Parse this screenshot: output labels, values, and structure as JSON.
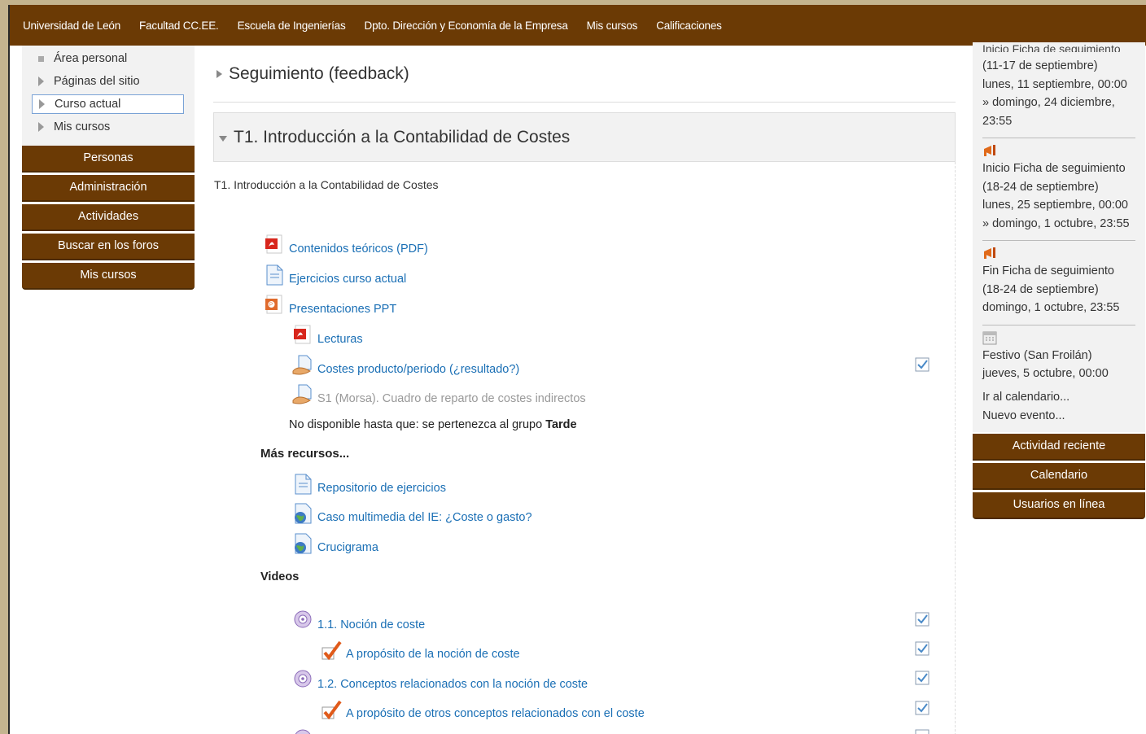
{
  "topnav": {
    "items": [
      "Universidad de León",
      "Facultad CC.EE.",
      "Escuela de Ingenierías",
      "Dpto. Dirección y Economía de la Empresa",
      "Mis cursos",
      "Calificaciones"
    ]
  },
  "navtree": {
    "items": [
      "Área personal",
      "Páginas del sitio",
      "Curso actual",
      "Mis cursos"
    ]
  },
  "left_blocks": [
    "Personas",
    "Administración",
    "Actividades",
    "Buscar en los foros",
    "Mis cursos"
  ],
  "events": {
    "clipped_text": "Inicio Ficha de seguimiento",
    "e1": {
      "l1": "(11-17 de septiembre)",
      "l2": "lunes, 11 septiembre, 00:00",
      "l3": "» domingo, 24 diciembre,",
      "l4": "23:55"
    },
    "e2": {
      "l1": "Inicio Ficha de seguimiento",
      "l2": "(18-24 de septiembre)",
      "l3": "lunes, 25 septiembre, 00:00",
      "l4": "» domingo, 1 octubre, 23:55"
    },
    "e3": {
      "l1": "Fin Ficha de seguimiento",
      "l2": "(18-24 de septiembre)",
      "l3": "domingo, 1 octubre, 23:55"
    },
    "e4": {
      "l1": "Festivo (San Froilán)",
      "l2": "jueves, 5 octubre, 00:00"
    },
    "goto_calendar": "Ir al calendario...",
    "new_event": "Nuevo evento..."
  },
  "right_blocks": [
    "Actividad reciente",
    "Calendario",
    "Usuarios en línea"
  ],
  "sections": {
    "collapsed_title": "Seguimiento (feedback)",
    "expanded_title": "T1. Introducción a la Contabilidad de Costes",
    "summary": "T1. Introducción a la Contabilidad de Costes"
  },
  "activities": [
    {
      "label": "Contenidos teóricos (PDF)",
      "icon": "pdf-icon"
    },
    {
      "label": "Ejercicios curso actual",
      "icon": "document-icon"
    },
    {
      "label": "Presentaciones PPT",
      "icon": "powerpoint-icon"
    },
    {
      "label": "Lecturas",
      "icon": "pdf-icon"
    },
    {
      "label": "Costes producto/periodo (¿resultado?)",
      "icon": "assignment-icon"
    },
    {
      "label": "S1 (Morsa). Cuadro de reparto de costes indirectos",
      "icon": "assignment-icon"
    },
    {
      "label": "Repositorio de ejercicios",
      "icon": "document-icon"
    },
    {
      "label": "Caso multimedia del IE: ¿Coste o gasto?",
      "icon": "url-icon"
    },
    {
      "label": "Crucigrama",
      "icon": "url-icon"
    },
    {
      "label": "1.1. Noción de coste",
      "icon": "video-icon"
    },
    {
      "label": "A propósito de la noción de coste",
      "icon": "quiz-icon"
    },
    {
      "label": "1.2. Conceptos relacionados con la noción de coste",
      "icon": "video-icon"
    },
    {
      "label": "A propósito de otros conceptos relacionados con el coste",
      "icon": "quiz-icon"
    }
  ],
  "restriction": {
    "prefix": "No disponible hasta que: se pertenezca al grupo ",
    "group": "Tarde"
  },
  "headings": {
    "more": "Más recursos...",
    "videos": "Videos"
  },
  "colors": {
    "brand": "#6b3a05",
    "link": "#1a6fb5",
    "background": "#c4b48f"
  }
}
